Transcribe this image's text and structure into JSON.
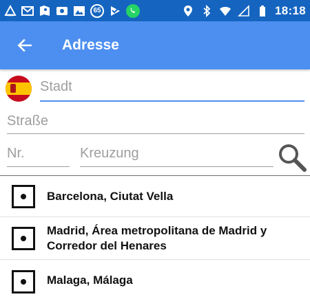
{
  "status_bar": {
    "time": "18:18",
    "notification_badge": "65",
    "icons": [
      "accessibility-icon",
      "gmail-icon",
      "maps-icon",
      "photo-icon",
      "gallery-icon",
      "badge-65",
      "play-icon",
      "whatsapp-icon",
      "location-icon",
      "bluetooth-icon",
      "wifi-icon",
      "signal-icon",
      "battery-icon"
    ]
  },
  "app_bar": {
    "title": "Adresse",
    "back_icon": "arrow-left-icon",
    "color": "#4d8ff0"
  },
  "form": {
    "country_flag": "Spain",
    "city_placeholder": "Stadt",
    "street_placeholder": "Straße",
    "nr_placeholder": "Nr.",
    "crossing_placeholder": "Kreuzung",
    "search_icon": "magnifier-icon"
  },
  "results": [
    {
      "label": "Barcelona, Ciutat Vella"
    },
    {
      "label": "Madrid, Área metropolitana de Madrid y Corredor del Henares"
    },
    {
      "label": "Malaga, Málaga"
    }
  ]
}
